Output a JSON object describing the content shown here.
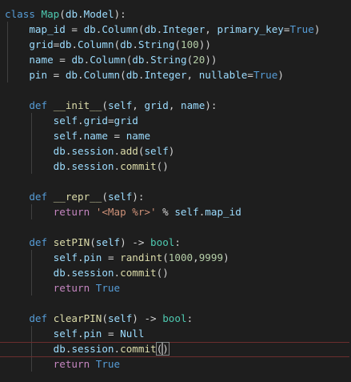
{
  "editor": {
    "language": "python",
    "cursor": {
      "line": 23,
      "after": "commit("
    },
    "colors": {
      "background": "#1e1e1e",
      "keyword": "#569cd6",
      "control": "#c586c0",
      "class": "#4ec9b0",
      "function": "#dcdcaa",
      "variable": "#9cdcfe",
      "number": "#b5cea8",
      "string": "#ce9178",
      "text": "#d4d4d4",
      "current_line_border": "#6b2e2e"
    },
    "lines": [
      [
        {
          "t": "class",
          "c": "kw"
        },
        {
          "t": " "
        },
        {
          "t": "Map",
          "c": "cls"
        },
        {
          "t": "("
        },
        {
          "t": "db",
          "c": "var"
        },
        {
          "t": "."
        },
        {
          "t": "Model",
          "c": "var"
        },
        {
          "t": "):"
        }
      ],
      [
        {
          "t": "    "
        },
        {
          "t": "map_id",
          "c": "var"
        },
        {
          "t": " = "
        },
        {
          "t": "db",
          "c": "var"
        },
        {
          "t": "."
        },
        {
          "t": "Column",
          "c": "var"
        },
        {
          "t": "("
        },
        {
          "t": "db",
          "c": "var"
        },
        {
          "t": "."
        },
        {
          "t": "Integer",
          "c": "var"
        },
        {
          "t": ", "
        },
        {
          "t": "primary_key",
          "c": "var"
        },
        {
          "t": "="
        },
        {
          "t": "True",
          "c": "kw"
        },
        {
          "t": ")"
        }
      ],
      [
        {
          "t": "    "
        },
        {
          "t": "grid",
          "c": "var"
        },
        {
          "t": "="
        },
        {
          "t": "db",
          "c": "var"
        },
        {
          "t": "."
        },
        {
          "t": "Column",
          "c": "var"
        },
        {
          "t": "("
        },
        {
          "t": "db",
          "c": "var"
        },
        {
          "t": "."
        },
        {
          "t": "String",
          "c": "var"
        },
        {
          "t": "("
        },
        {
          "t": "100",
          "c": "num"
        },
        {
          "t": "))"
        }
      ],
      [
        {
          "t": "    "
        },
        {
          "t": "name",
          "c": "var"
        },
        {
          "t": " = "
        },
        {
          "t": "db",
          "c": "var"
        },
        {
          "t": "."
        },
        {
          "t": "Column",
          "c": "var"
        },
        {
          "t": "("
        },
        {
          "t": "db",
          "c": "var"
        },
        {
          "t": "."
        },
        {
          "t": "String",
          "c": "var"
        },
        {
          "t": "("
        },
        {
          "t": "20",
          "c": "num"
        },
        {
          "t": "))"
        }
      ],
      [
        {
          "t": "    "
        },
        {
          "t": "pin",
          "c": "var"
        },
        {
          "t": " = "
        },
        {
          "t": "db",
          "c": "var"
        },
        {
          "t": "."
        },
        {
          "t": "Column",
          "c": "var"
        },
        {
          "t": "("
        },
        {
          "t": "db",
          "c": "var"
        },
        {
          "t": "."
        },
        {
          "t": "Integer",
          "c": "var"
        },
        {
          "t": ", "
        },
        {
          "t": "nullable",
          "c": "var"
        },
        {
          "t": "="
        },
        {
          "t": "True",
          "c": "kw"
        },
        {
          "t": ")"
        }
      ],
      [],
      [
        {
          "t": "    "
        },
        {
          "t": "def",
          "c": "kw"
        },
        {
          "t": " "
        },
        {
          "t": "__init__",
          "c": "fn"
        },
        {
          "t": "("
        },
        {
          "t": "self",
          "c": "var"
        },
        {
          "t": ", "
        },
        {
          "t": "grid",
          "c": "var"
        },
        {
          "t": ", "
        },
        {
          "t": "name",
          "c": "var"
        },
        {
          "t": "):"
        }
      ],
      [
        {
          "t": "        "
        },
        {
          "t": "self",
          "c": "var"
        },
        {
          "t": "."
        },
        {
          "t": "grid",
          "c": "var"
        },
        {
          "t": "="
        },
        {
          "t": "grid",
          "c": "var"
        }
      ],
      [
        {
          "t": "        "
        },
        {
          "t": "self",
          "c": "var"
        },
        {
          "t": "."
        },
        {
          "t": "name",
          "c": "var"
        },
        {
          "t": " = "
        },
        {
          "t": "name",
          "c": "var"
        }
      ],
      [
        {
          "t": "        "
        },
        {
          "t": "db",
          "c": "var"
        },
        {
          "t": "."
        },
        {
          "t": "session",
          "c": "var"
        },
        {
          "t": "."
        },
        {
          "t": "add",
          "c": "fn"
        },
        {
          "t": "("
        },
        {
          "t": "self",
          "c": "var"
        },
        {
          "t": ")"
        }
      ],
      [
        {
          "t": "        "
        },
        {
          "t": "db",
          "c": "var"
        },
        {
          "t": "."
        },
        {
          "t": "session",
          "c": "var"
        },
        {
          "t": "."
        },
        {
          "t": "commit",
          "c": "fn"
        },
        {
          "t": "()"
        }
      ],
      [],
      [
        {
          "t": "    "
        },
        {
          "t": "def",
          "c": "kw"
        },
        {
          "t": " "
        },
        {
          "t": "__repr__",
          "c": "fn"
        },
        {
          "t": "("
        },
        {
          "t": "self",
          "c": "var"
        },
        {
          "t": "):"
        }
      ],
      [
        {
          "t": "        "
        },
        {
          "t": "return",
          "c": "ctl"
        },
        {
          "t": " "
        },
        {
          "t": "'<Map %r>'",
          "c": "str"
        },
        {
          "t": " % "
        },
        {
          "t": "self",
          "c": "var"
        },
        {
          "t": "."
        },
        {
          "t": "map_id",
          "c": "var"
        }
      ],
      [],
      [
        {
          "t": "    "
        },
        {
          "t": "def",
          "c": "kw"
        },
        {
          "t": " "
        },
        {
          "t": "setPIN",
          "c": "fn"
        },
        {
          "t": "("
        },
        {
          "t": "self",
          "c": "var"
        },
        {
          "t": ") -> "
        },
        {
          "t": "bool",
          "c": "cls"
        },
        {
          "t": ":"
        }
      ],
      [
        {
          "t": "        "
        },
        {
          "t": "self",
          "c": "var"
        },
        {
          "t": "."
        },
        {
          "t": "pin",
          "c": "var"
        },
        {
          "t": " = "
        },
        {
          "t": "randint",
          "c": "fn"
        },
        {
          "t": "("
        },
        {
          "t": "1000",
          "c": "num"
        },
        {
          "t": ","
        },
        {
          "t": "9999",
          "c": "num"
        },
        {
          "t": ")"
        }
      ],
      [
        {
          "t": "        "
        },
        {
          "t": "db",
          "c": "var"
        },
        {
          "t": "."
        },
        {
          "t": "session",
          "c": "var"
        },
        {
          "t": "."
        },
        {
          "t": "commit",
          "c": "fn"
        },
        {
          "t": "()"
        }
      ],
      [
        {
          "t": "        "
        },
        {
          "t": "return",
          "c": "ctl"
        },
        {
          "t": " "
        },
        {
          "t": "True",
          "c": "kw"
        }
      ],
      [],
      [
        {
          "t": "    "
        },
        {
          "t": "def",
          "c": "kw"
        },
        {
          "t": " "
        },
        {
          "t": "clearPIN",
          "c": "fn"
        },
        {
          "t": "("
        },
        {
          "t": "self",
          "c": "var"
        },
        {
          "t": ") -> "
        },
        {
          "t": "bool",
          "c": "cls"
        },
        {
          "t": ":"
        }
      ],
      [
        {
          "t": "        "
        },
        {
          "t": "self",
          "c": "var"
        },
        {
          "t": "."
        },
        {
          "t": "pin",
          "c": "var"
        },
        {
          "t": " = "
        },
        {
          "t": "Null",
          "c": "var"
        }
      ],
      [
        {
          "t": "        "
        },
        {
          "t": "db",
          "c": "var"
        },
        {
          "t": "."
        },
        {
          "t": "session",
          "c": "var"
        },
        {
          "t": "."
        },
        {
          "t": "commit",
          "c": "fn"
        },
        {
          "t": "("
        },
        {
          "t": ")",
          "m": "match"
        }
      ],
      [
        {
          "t": "        "
        },
        {
          "t": "return",
          "c": "ctl"
        },
        {
          "t": " "
        },
        {
          "t": "True",
          "c": "kw"
        }
      ]
    ]
  }
}
